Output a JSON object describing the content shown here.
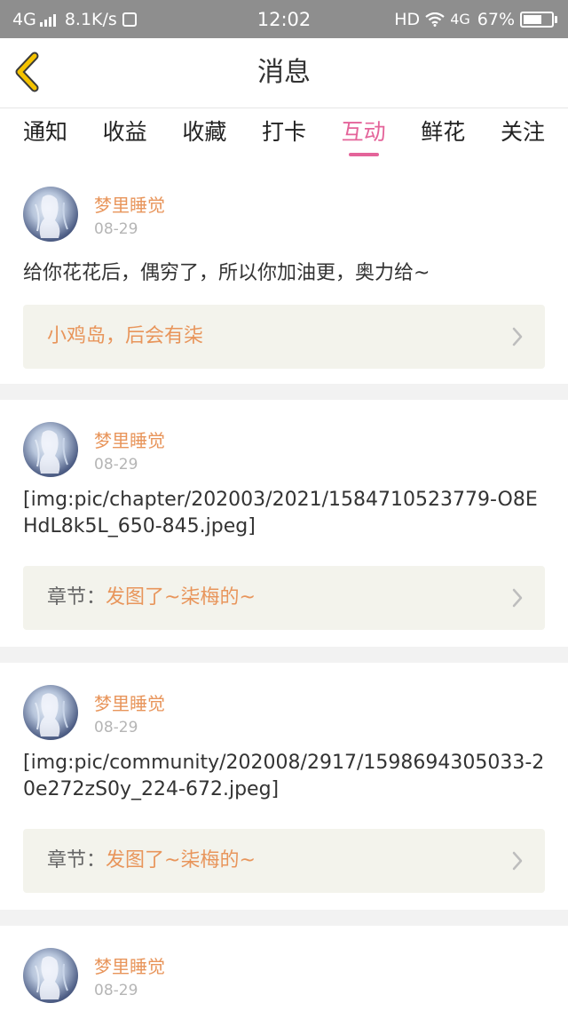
{
  "status_bar": {
    "network": "4G",
    "speed": "8.1K/s",
    "time": "12:02",
    "hd": "HD",
    "data_type": "4G",
    "battery": "67%",
    "battery_level": 0.67
  },
  "header": {
    "title": "消息",
    "back_icon": "chevron-left-icon",
    "accent_color": "#f5c300"
  },
  "tabs": [
    {
      "label": "通知",
      "active": false
    },
    {
      "label": "收益",
      "active": false
    },
    {
      "label": "收藏",
      "active": false
    },
    {
      "label": "打卡",
      "active": false
    },
    {
      "label": "互动",
      "active": true
    },
    {
      "label": "鲜花",
      "active": false
    },
    {
      "label": "关注",
      "active": false
    }
  ],
  "colors": {
    "tab_active": "#e4649a",
    "username": "#e8955b",
    "ref_background": "#f3f3ec"
  },
  "messages": [
    {
      "username": "梦里睡觉",
      "date": "08-29",
      "text": "给你花花后，偶穷了，所以你加油更，奥力给~",
      "ref_prefix": "",
      "ref_title": "小鸡岛，后会有柒"
    },
    {
      "username": "梦里睡觉",
      "date": "08-29",
      "text": "[img:pic/chapter/202003/2021/1584710523779-O8EHdL8k5L_650-845.jpeg]",
      "ref_prefix": "章节：",
      "ref_title": "发图了~柒梅的~"
    },
    {
      "username": "梦里睡觉",
      "date": "08-29",
      "text": "[img:pic/community/202008/2917/1598694305033-20e272zS0y_224-672.jpeg]",
      "ref_prefix": "章节：",
      "ref_title": "发图了~柒梅的~"
    },
    {
      "username": "梦里睡觉",
      "date": "08-29"
    }
  ]
}
